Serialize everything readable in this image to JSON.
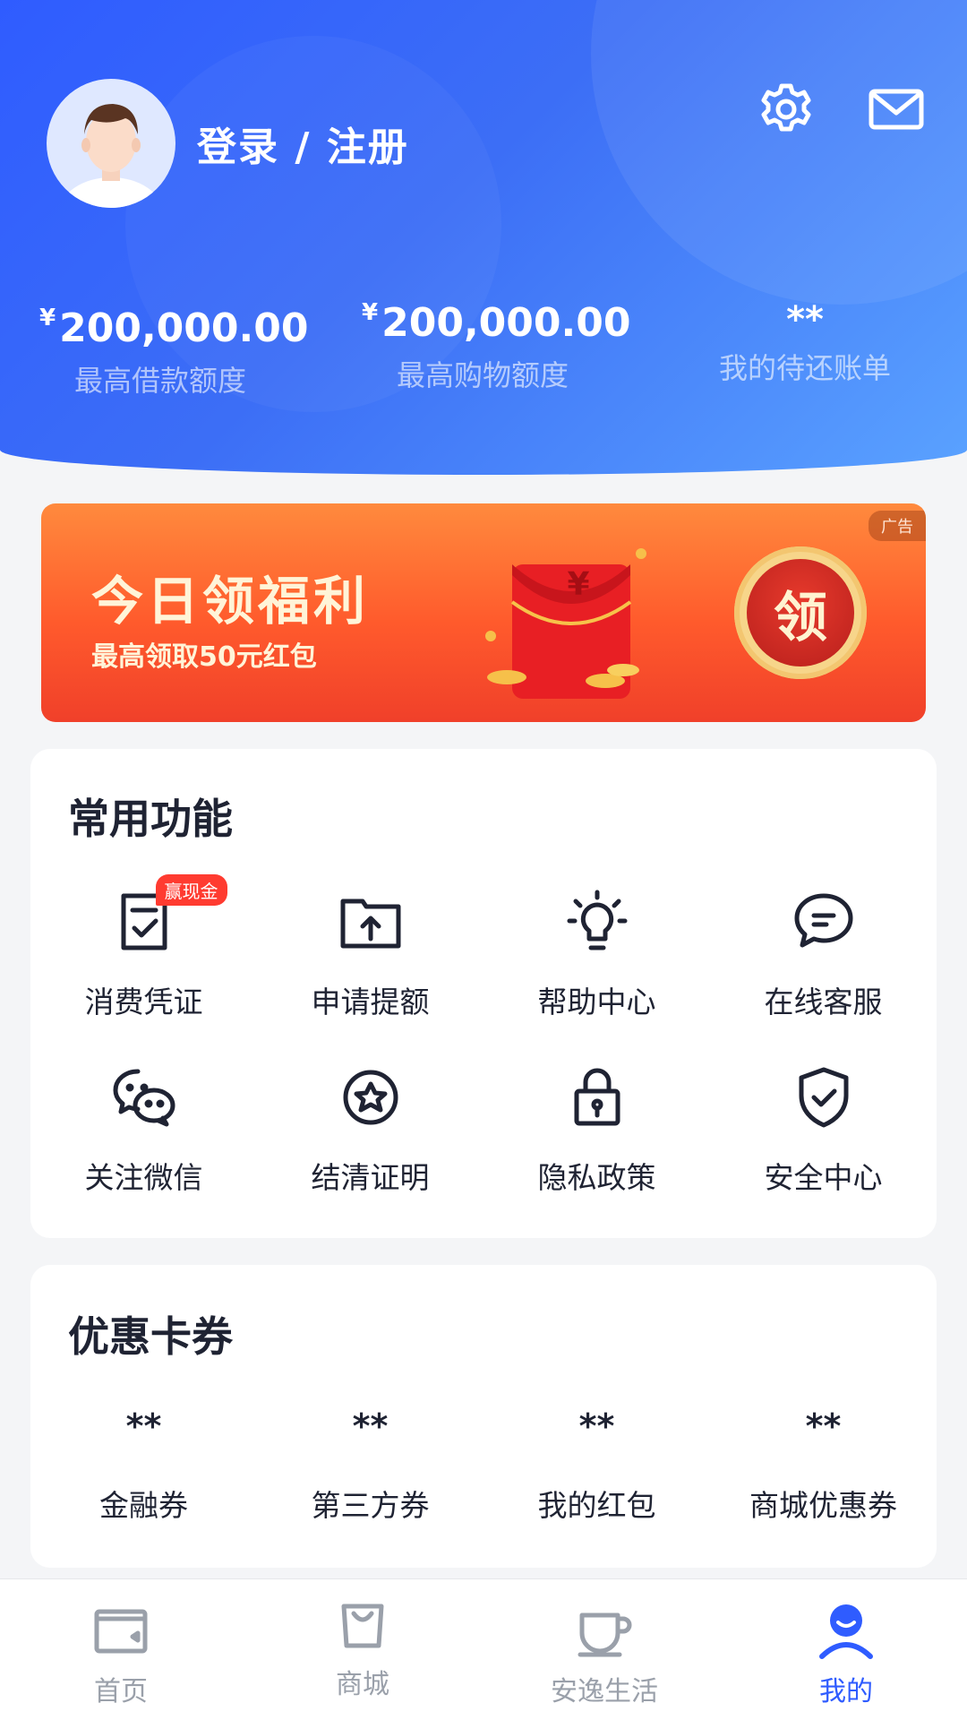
{
  "header": {
    "login_text": "登录 / 注册",
    "icons": [
      "settings-gear-icon",
      "mail-icon"
    ]
  },
  "stats": [
    {
      "currency": "¥",
      "amount": "200,000.00",
      "label": "最高借款额度"
    },
    {
      "currency": "¥",
      "amount": "200,000.00",
      "label": "最高购物额度"
    },
    {
      "amount": "**",
      "label": "我的待还账单"
    }
  ],
  "banner": {
    "ad_tag": "广告",
    "title": "今日领福利",
    "subtitle": "最高领取50元红包",
    "envelope_symbol": "¥",
    "button": "领"
  },
  "common_functions": {
    "title": "常用功能",
    "items": [
      {
        "label": "消费凭证",
        "icon": "receipt-check-icon",
        "badge": "赢现金"
      },
      {
        "label": "申请提额",
        "icon": "folder-upload-icon"
      },
      {
        "label": "帮助中心",
        "icon": "lightbulb-icon"
      },
      {
        "label": "在线客服",
        "icon": "chat-bubble-icon"
      },
      {
        "label": "关注微信",
        "icon": "wechat-icon"
      },
      {
        "label": "结清证明",
        "icon": "star-badge-icon"
      },
      {
        "label": "隐私政策",
        "icon": "lock-icon"
      },
      {
        "label": "安全中心",
        "icon": "shield-check-icon"
      }
    ]
  },
  "coupons": {
    "title": "优惠卡券",
    "items": [
      {
        "value": "**",
        "label": "金融券"
      },
      {
        "value": "**",
        "label": "第三方券"
      },
      {
        "value": "**",
        "label": "我的红包"
      },
      {
        "value": "**",
        "label": "商城优惠券"
      }
    ]
  },
  "tabbar": {
    "items": [
      {
        "label": "首页",
        "icon": "home-wallet-icon",
        "active": false
      },
      {
        "label": "商城",
        "icon": "shopping-bag-icon",
        "active": false
      },
      {
        "label": "安逸生活",
        "icon": "coffee-cup-icon",
        "active": false
      },
      {
        "label": "我的",
        "icon": "user-profile-icon",
        "active": true
      }
    ],
    "active_color": "#2f5cff",
    "inactive_color": "#9aa0aa"
  },
  "colors": {
    "hero_blue": "#2f5cff",
    "banner_red": "#f0402a",
    "badge_red": "#ff3b30"
  }
}
